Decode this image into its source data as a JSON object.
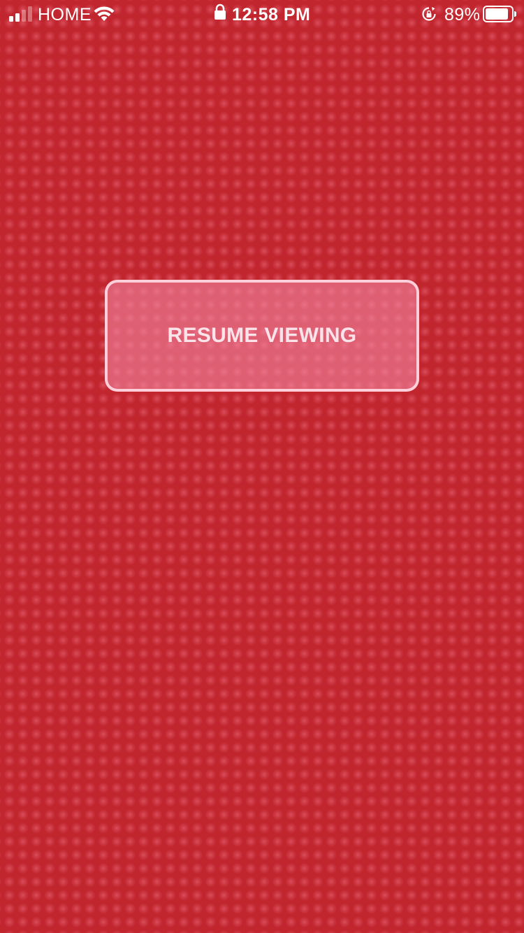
{
  "status_bar": {
    "carrier": "HOME",
    "time": "12:58 PM",
    "battery_percent": "89%",
    "battery_level": 0.89,
    "signal_bars_filled": 2,
    "signal_bars_total": 4,
    "icons": [
      "signal-icon",
      "wifi-icon",
      "lock-icon",
      "rotation-lock-icon",
      "battery-icon"
    ]
  },
  "main": {
    "resume_label": "RESUME VIEWING"
  },
  "colors": {
    "background": "#c1262f",
    "button_fill": "#e96b8a",
    "button_border": "#ffdce4",
    "text": "#ffffff"
  }
}
